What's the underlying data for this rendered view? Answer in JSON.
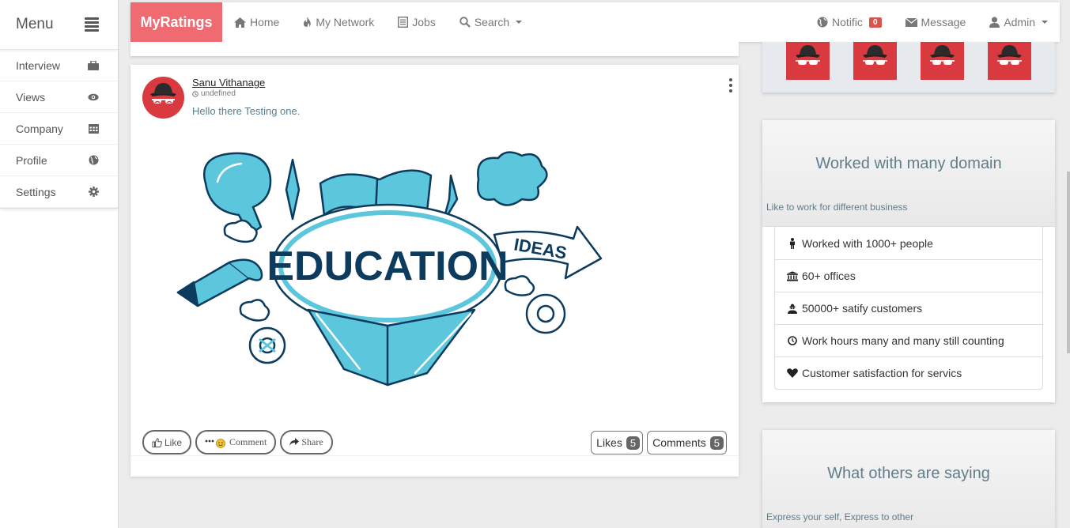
{
  "sidebar": {
    "title": "Menu",
    "items": [
      {
        "label": "Interview",
        "icon": "briefcase-icon"
      },
      {
        "label": "Views",
        "icon": "eye-icon"
      },
      {
        "label": "Company",
        "icon": "calendar-icon"
      },
      {
        "label": "Profile",
        "icon": "globe-icon"
      },
      {
        "label": "Settings",
        "icon": "gear-icon"
      }
    ]
  },
  "navbar": {
    "brand": "MyRatings",
    "home": "Home",
    "network": "My Network",
    "jobs": "Jobs",
    "search": "Search",
    "notific": "Notific",
    "notific_count": "0",
    "message": "Message",
    "admin": "Admin"
  },
  "post": {
    "author": "Sanu Vithanage",
    "time": "undefined",
    "text": "Hello there Testing one.",
    "like": "Like",
    "comment": "Comment",
    "share": "Share",
    "likes_label": "Likes",
    "likes_count": "5",
    "comments_label": "Comments",
    "comments_count": "5"
  },
  "image": {
    "main_word": "EDUCATION",
    "ideas_word": "IDEAS"
  },
  "panel1": {
    "title": "Worked with many domain",
    "subtitle": "Like to work for different business",
    "items": [
      {
        "text": "Worked with 1000+ people",
        "icon": "male-icon"
      },
      {
        "text": "60+ offices",
        "icon": "bank-icon"
      },
      {
        "text": "50000+ satify customers",
        "icon": "user-secret-icon"
      },
      {
        "text": "Work hours many and many still counting",
        "icon": "clock-icon"
      },
      {
        "text": "Customer satisfaction for servics",
        "icon": "heart-icon"
      }
    ]
  },
  "panel2": {
    "title": "What others are saying",
    "subtitle": "Express your self, Express to other"
  },
  "colors": {
    "brand": "#f06a72",
    "badge": "#d9534f",
    "panel_text": "#607d8b"
  }
}
